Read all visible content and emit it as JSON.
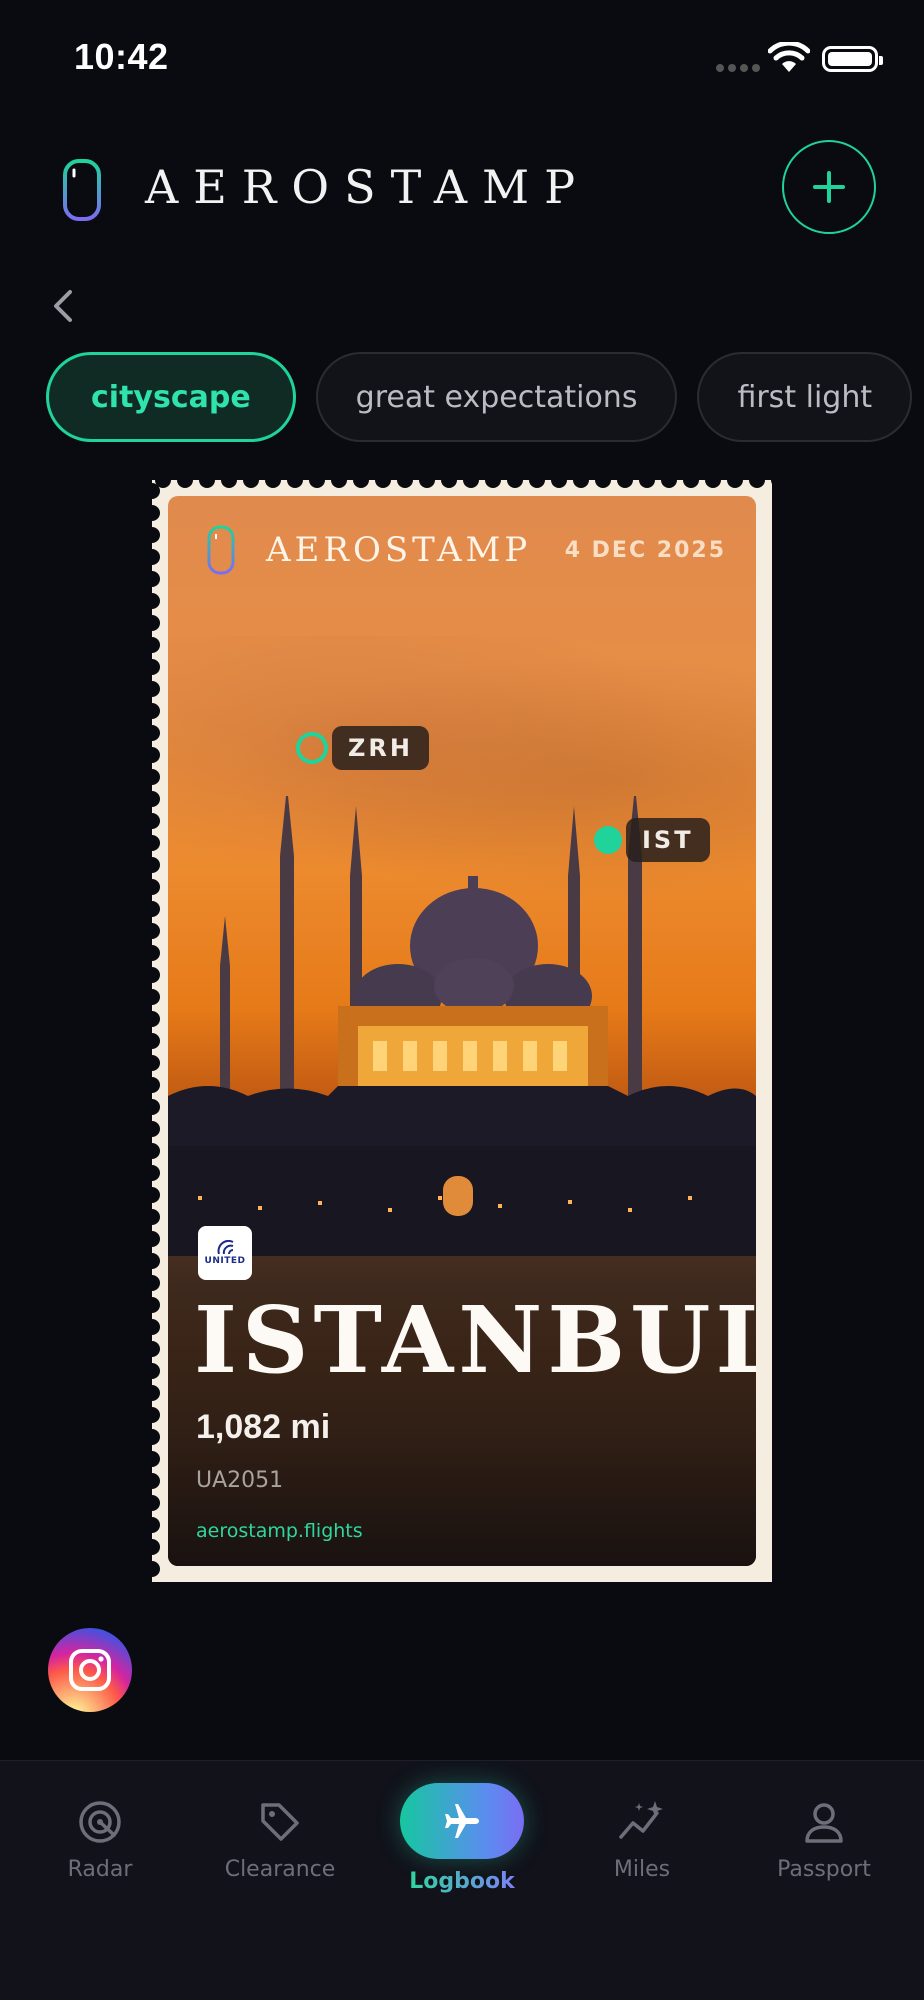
{
  "status_bar": {
    "time": "10:42"
  },
  "header": {
    "brand": "AEROSTAMP"
  },
  "chips": [
    {
      "label": "cityscape",
      "active": true
    },
    {
      "label": "great expectations",
      "active": false
    },
    {
      "label": "first light",
      "active": false
    }
  ],
  "stamp": {
    "brand": "AEROSTAMP",
    "date": "4 DEC 2025",
    "origin": "ZRH",
    "destination": "IST",
    "airline": "UNITED",
    "city": "ISTANBUL",
    "distance": "1,082 mi",
    "flight_number": "UA2051",
    "website": "aerostamp.flights"
  },
  "tabs": {
    "radar": "Radar",
    "clearance": "Clearance",
    "logbook": "Logbook",
    "miles": "Miles",
    "passport": "Passport"
  },
  "colors": {
    "accent": "#1fd39b",
    "background": "#0a0b10"
  }
}
